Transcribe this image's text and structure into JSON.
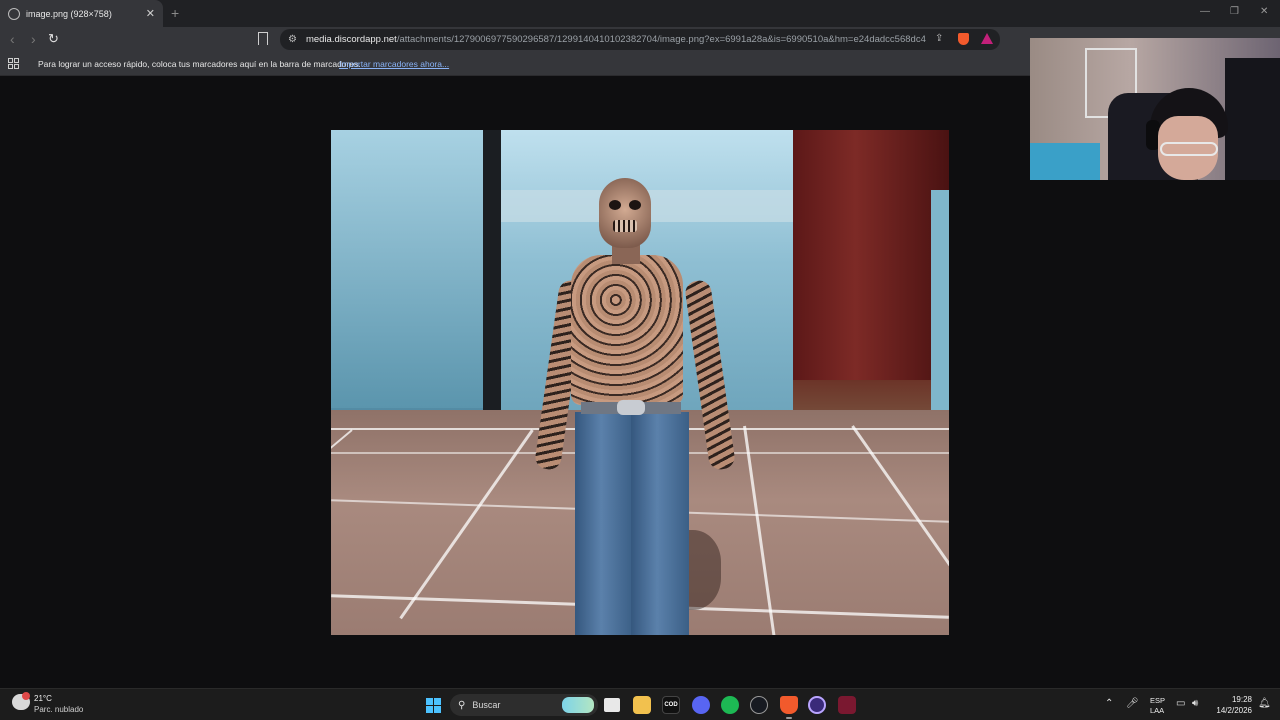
{
  "browser": {
    "tab": {
      "title": "image.png (928×758)"
    },
    "new_tab_label": "+",
    "omnibox": {
      "domain": "media.discordapp.net",
      "path": "/attachments/1279006977590296587/1299140410102382704/image.png?ex=6991a28a&is=6990510a&hm=e24dadcc568dc4b..."
    },
    "bookmarks_bar": {
      "message": "Para lograr un acceso rápido, coloca tus marcadores aquí en la barra de marcadores.",
      "import_link": "Importar marcadores ahora..."
    }
  },
  "content": {
    "image_description": "Displayed image: game character with full-body skull tattoos wearing jeans, standing on tiled floor"
  },
  "taskbar": {
    "weather": {
      "temp": "21°C",
      "condition": "Parc. nublado"
    },
    "search_placeholder": "Buscar",
    "language": {
      "line1": "ESP",
      "line2": "LAA"
    },
    "clock": {
      "time": "19:28",
      "date": "14/2/2026"
    },
    "apps": [
      "task-view",
      "file-explorer",
      "call-of-duty",
      "discord",
      "spotify",
      "steam",
      "brave",
      "obs",
      "game-app"
    ]
  },
  "colors": {
    "accent": "#4cc2ff",
    "link": "#8ab4f8",
    "brave": "#f25a2c",
    "spotify": "#1db954",
    "discord": "#5865f2"
  }
}
